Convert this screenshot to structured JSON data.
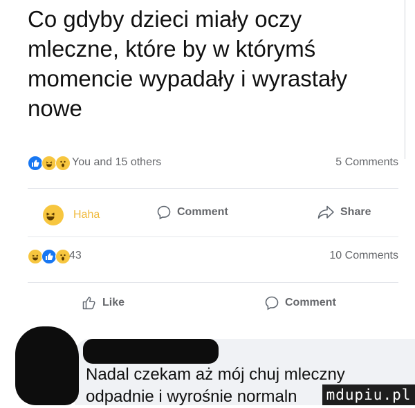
{
  "post": {
    "lines": [
      "Co gdyby dzieci miały oczy",
      "mleczne, które by w którymś",
      "momencie wypadały i wyrastały",
      "nowe"
    ]
  },
  "reaction_bar_1": {
    "icons": [
      "like-icon",
      "haha-icon",
      "wow-icon"
    ],
    "text": "You and 15 others",
    "comments": "5 Comments"
  },
  "action_bar_1": {
    "reaction_label": "Haha",
    "comment_label": "Comment",
    "share_label": "Share"
  },
  "reaction_bar_2": {
    "icons": [
      "haha-icon",
      "like-icon",
      "wow-icon"
    ],
    "count": "43",
    "comments": "10 Comments"
  },
  "action_bar_2": {
    "like_label": "Like",
    "comment_label": "Comment"
  },
  "comment": {
    "lines": [
      "Nadal czekam aż mój chuj mleczny",
      "odpadnie i wyrośnie normaln"
    ]
  },
  "watermark": {
    "text": "mdupiu.pl"
  },
  "colors": {
    "like_blue": "#1877f2",
    "haha_yellow": "#f7c63f",
    "secondary_text": "#65676b",
    "bubble_bg": "#f0f2f5"
  }
}
